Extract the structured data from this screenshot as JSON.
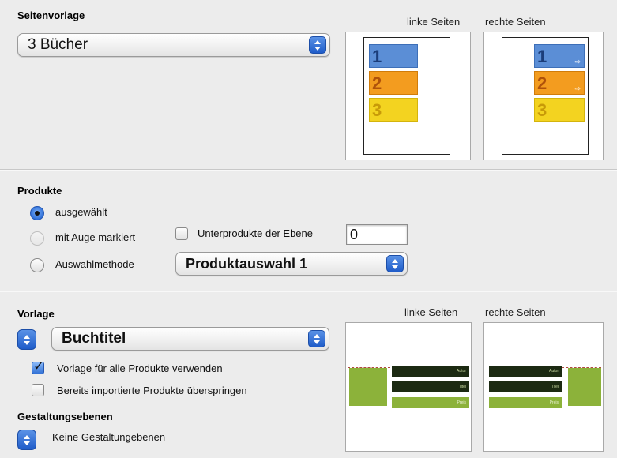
{
  "seitenvorlage": {
    "heading": "Seitenvorlage",
    "selected": "3 Bücher",
    "left_caption": "linke Seiten",
    "right_caption": "rechte Seiten",
    "blocks": [
      "1",
      "2",
      "3"
    ]
  },
  "produkte": {
    "heading": "Produkte",
    "radio_selected_label": "ausgewählt",
    "radio_eye_label": "mit Auge markiert",
    "radio_method_label": "Auswahlmethode",
    "subproducts_label": "Unterprodukte der Ebene",
    "subproducts_level": "0",
    "method_selected": "Produktauswahl 1"
  },
  "vorlage": {
    "heading": "Vorlage",
    "selected": "Buchtitel",
    "left_caption": "linke Seiten",
    "right_caption": "rechte Seiten",
    "use_for_all_label": "Vorlage für alle Produkte verwenden",
    "use_for_all_checked": true,
    "skip_imported_label": "Bereits importierte Produkte überspringen",
    "skip_imported_checked": false,
    "left_bars": [
      "Autor",
      "Titel",
      "Preis"
    ],
    "right_bars": [
      "Autor",
      "Titel",
      "Preis"
    ]
  },
  "gestaltung": {
    "heading": "Gestaltungsebenen",
    "value": "Keine Gestaltungebenen"
  },
  "colors": {
    "accent": "#2f6fd8",
    "block1": "#5b8ed6",
    "block2": "#f39c1f",
    "block3": "#f3d320",
    "template_green": "#8cb23a",
    "template_dark": "#1c2a12"
  }
}
